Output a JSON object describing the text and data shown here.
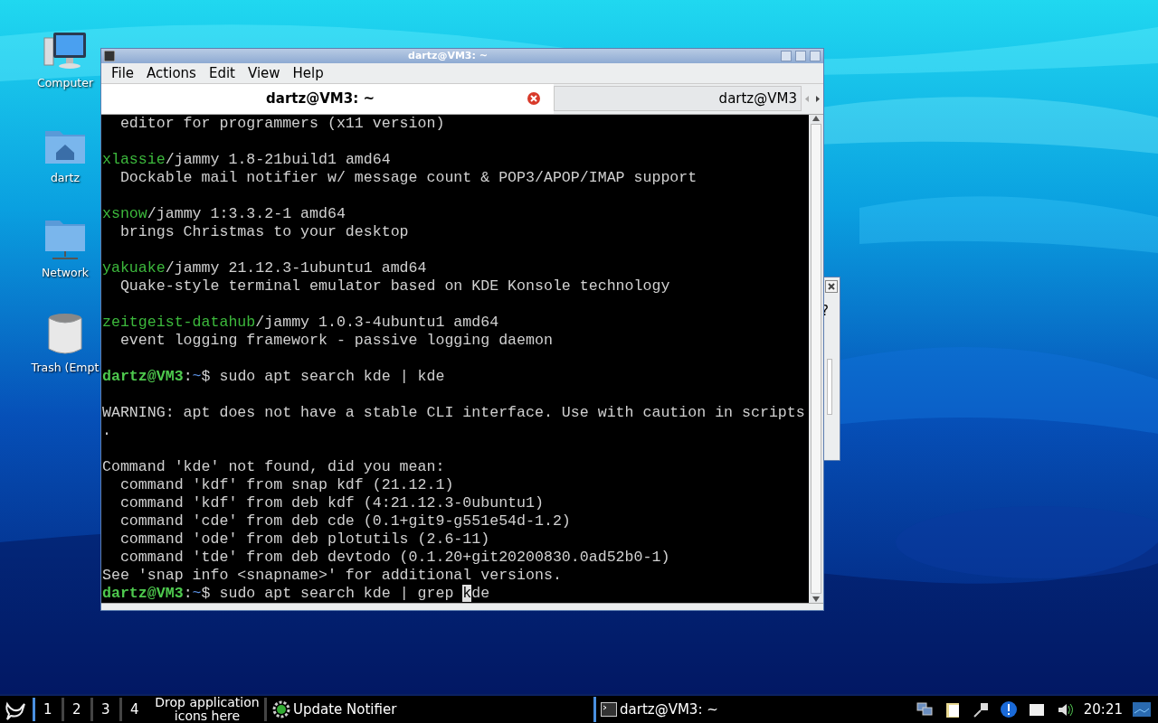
{
  "desktop_icons": [
    {
      "kind": "computer",
      "label": "Computer"
    },
    {
      "kind": "home",
      "label": "dartz"
    },
    {
      "kind": "network",
      "label": "Network"
    },
    {
      "kind": "trash",
      "label": "Trash (Empt"
    }
  ],
  "background_dialog": {
    "text": "?"
  },
  "window": {
    "title": "dartz@VM3: ~",
    "menu": [
      "File",
      "Actions",
      "Edit",
      "View",
      "Help"
    ],
    "tabs": [
      {
        "label": "dartz@VM3: ~",
        "selected": true
      },
      {
        "label": "dartz@VM3",
        "selected": false
      }
    ],
    "terminal_lines": [
      {
        "kind": "text",
        "text": "  editor for programmers (x11 version)"
      },
      {
        "kind": "blank"
      },
      {
        "kind": "package",
        "name": "xlassie",
        "rest": "/jammy 1.8-21build1 amd64"
      },
      {
        "kind": "text",
        "text": "  Dockable mail notifier w/ message count & POP3/APOP/IMAP support"
      },
      {
        "kind": "blank"
      },
      {
        "kind": "package",
        "name": "xsnow",
        "rest": "/jammy 1:3.3.2-1 amd64"
      },
      {
        "kind": "text",
        "text": "  brings Christmas to your desktop"
      },
      {
        "kind": "blank"
      },
      {
        "kind": "package",
        "name": "yakuake",
        "rest": "/jammy 21.12.3-1ubuntu1 amd64"
      },
      {
        "kind": "text",
        "text": "  Quake-style terminal emulator based on KDE Konsole technology"
      },
      {
        "kind": "blank"
      },
      {
        "kind": "package",
        "name": "zeitgeist-datahub",
        "rest": "/jammy 1.0.3-4ubuntu1 amd64"
      },
      {
        "kind": "text",
        "text": "  event logging framework - passive logging daemon"
      },
      {
        "kind": "blank"
      },
      {
        "kind": "prompt",
        "user": "dartz@VM3",
        "sep": ":",
        "path": "~",
        "command": "$ sudo apt search kde | kde"
      },
      {
        "kind": "blank"
      },
      {
        "kind": "text",
        "text": "WARNING: apt does not have a stable CLI interface. Use with caution in scripts"
      },
      {
        "kind": "text",
        "text": "."
      },
      {
        "kind": "blank"
      },
      {
        "kind": "text",
        "text": "Command 'kde' not found, did you mean:"
      },
      {
        "kind": "text",
        "text": "  command 'kdf' from snap kdf (21.12.1)"
      },
      {
        "kind": "text",
        "text": "  command 'kdf' from deb kdf (4:21.12.3-0ubuntu1)"
      },
      {
        "kind": "text",
        "text": "  command 'cde' from deb cde (0.1+git9-g551e54d-1.2)"
      },
      {
        "kind": "text",
        "text": "  command 'ode' from deb plotutils (2.6-11)"
      },
      {
        "kind": "text",
        "text": "  command 'tde' from deb devtodo (0.1.20+git20200830.0ad52b0-1)"
      },
      {
        "kind": "text",
        "text": "See 'snap info <snapname>' for additional versions."
      },
      {
        "kind": "prompt",
        "user": "dartz@VM3",
        "sep": ":",
        "path": "~",
        "command": "$ sudo apt search kde | grep ",
        "cursor_char": "k",
        "after": "de"
      }
    ]
  },
  "taskbar": {
    "workspaces": [
      {
        "label": "1",
        "selected": true
      },
      {
        "label": "2",
        "selected": false
      },
      {
        "label": "3",
        "selected": false
      },
      {
        "label": "4",
        "selected": false
      }
    ],
    "launcher_hint": "Drop application icons here",
    "apps": [
      {
        "kind": "updater",
        "label": "Update Notifier"
      },
      {
        "kind": "terminal",
        "label": "dartz@VM3: ~"
      }
    ],
    "tray": [
      {
        "kind": "network"
      },
      {
        "kind": "clipboard"
      },
      {
        "kind": "plug"
      },
      {
        "kind": "info"
      },
      {
        "kind": "drive"
      },
      {
        "kind": "volume"
      }
    ],
    "clock": "20:21"
  }
}
